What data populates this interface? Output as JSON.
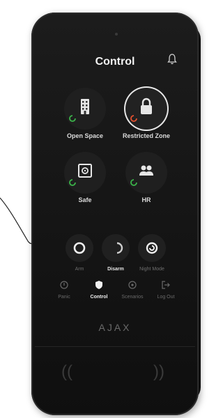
{
  "screen": {
    "title": "Control"
  },
  "zones": [
    {
      "label": "Open Space",
      "icon": "building-icon",
      "armed": false,
      "status_color": "#3bb54a"
    },
    {
      "label": "Restricted Zone",
      "icon": "lock-icon",
      "armed": true,
      "status_color": "#e8512e"
    },
    {
      "label": "Safe",
      "icon": "safe-icon",
      "armed": false,
      "status_color": "#3bb54a"
    },
    {
      "label": "HR",
      "icon": "people-icon",
      "armed": false,
      "status_color": "#3bb54a"
    }
  ],
  "modes": [
    {
      "label": "Arm",
      "icon": "arm-icon",
      "active": false
    },
    {
      "label": "Disarm",
      "icon": "disarm-icon",
      "active": true
    },
    {
      "label": "Night Mode",
      "icon": "night-mode-icon",
      "active": false
    }
  ],
  "nav": [
    {
      "label": "Panic",
      "icon": "panic-icon",
      "active": false
    },
    {
      "label": "Control",
      "icon": "shield-icon",
      "active": true
    },
    {
      "label": "Scenarios",
      "icon": "scenarios-icon",
      "active": false
    },
    {
      "label": "Log Out",
      "icon": "logout-icon",
      "active": false
    }
  ],
  "brand": {
    "logo": "AJAX"
  },
  "colors": {
    "armed_status": "#e8512e",
    "disarmed_status": "#3bb54a",
    "body": "#161616"
  }
}
